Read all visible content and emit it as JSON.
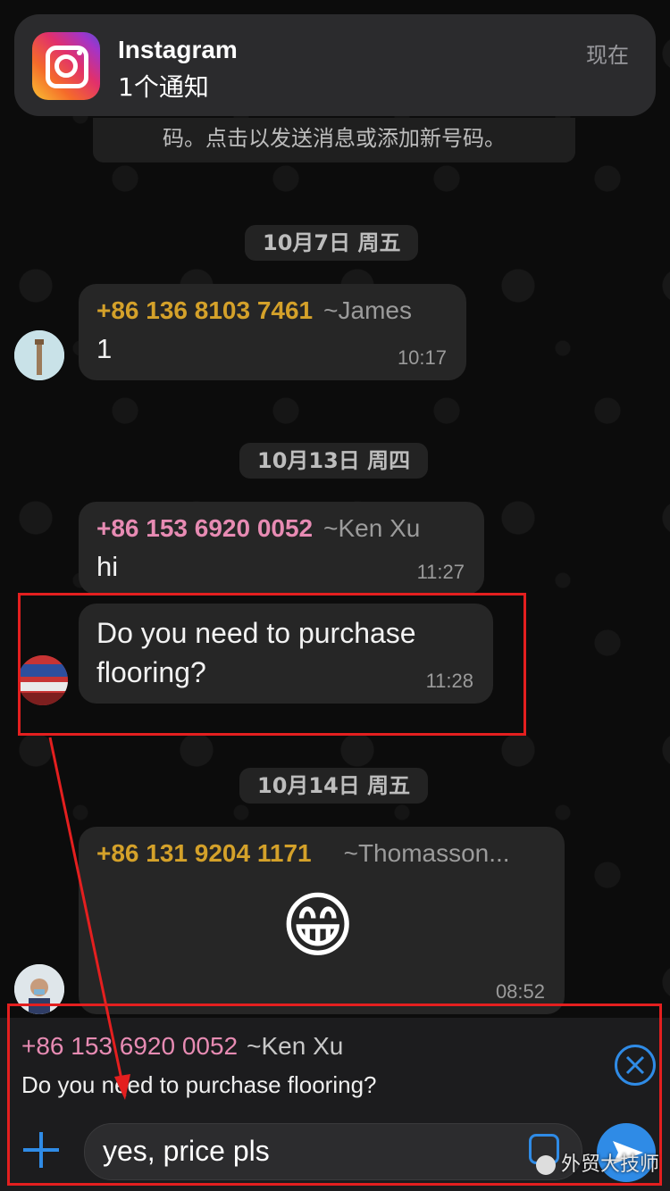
{
  "notification": {
    "app": "Instagram",
    "subtitle": "1个通知",
    "time": "现在"
  },
  "system_message": "码。点击以发送消息或添加新号码。",
  "dates": [
    "10月7日 周五",
    "10月13日 周四",
    "10月14日 周五"
  ],
  "messages": [
    {
      "phone": "+86 136 8103 7461",
      "alias": "~James",
      "text": "1",
      "time": "10:17",
      "phone_color": "#d4a12a"
    },
    {
      "phone": "+86 153 6920 0052",
      "alias": "~Ken Xu",
      "text": "hi",
      "time": "11:27",
      "phone_color": "#e78bb3"
    },
    {
      "text1": "Do you need to purchase",
      "text2": "flooring?",
      "time": "11:28"
    },
    {
      "phone": "+86 131 9204 1171",
      "alias": "~Thomasson...",
      "emoji": "😁",
      "time": "08:52",
      "phone_color": "#d4a12a"
    }
  ],
  "reply": {
    "phone": "+86 153 6920 0052",
    "alias": "~Ken Xu",
    "text": "Do you need to purchase flooring?"
  },
  "composer": {
    "value": "yes, price pls"
  },
  "watermark": "外贸大技师",
  "colors": {
    "accent": "#2f8be6",
    "annotation": "#e41f1f"
  }
}
